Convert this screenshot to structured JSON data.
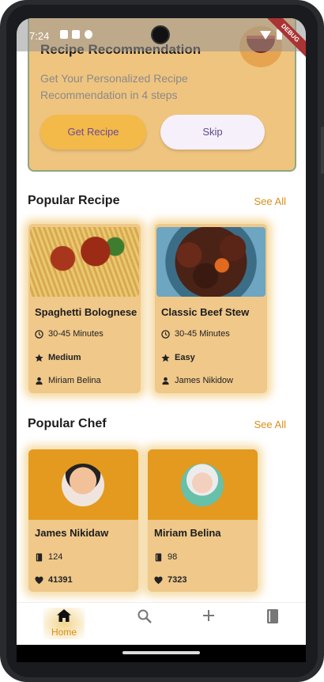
{
  "status_bar": {
    "time": "7:24",
    "debug_label": "DEBUG"
  },
  "recommendation": {
    "title": "Recipe Recommendation",
    "subtitle": "Get Your Personalized Recipe Recommendation in 4 steps",
    "get_label": "Get Recipe",
    "skip_label": "Skip"
  },
  "popular_recipe": {
    "title": "Popular Recipe",
    "see_all": "See All",
    "items": [
      {
        "name": "Spaghetti Bolognese",
        "time": "30-45 Minutes",
        "difficulty": "Medium",
        "chef": "Miriam Belina"
      },
      {
        "name": "Classic Beef Stew",
        "time": "30-45 Minutes",
        "difficulty": "Easy",
        "chef": "James Nikidow"
      }
    ]
  },
  "popular_chef": {
    "title": "Popular Chef",
    "see_all": "See All",
    "items": [
      {
        "name": "James Nikidaw",
        "recipes": "124",
        "likes": "41391"
      },
      {
        "name": "Miriam Belina",
        "recipes": "98",
        "likes": "7323"
      }
    ]
  },
  "nav": {
    "home_label": "Home"
  },
  "colors": {
    "accent": "#d78f1c",
    "card": "#efc88a",
    "chef_header": "#e39a1e"
  }
}
